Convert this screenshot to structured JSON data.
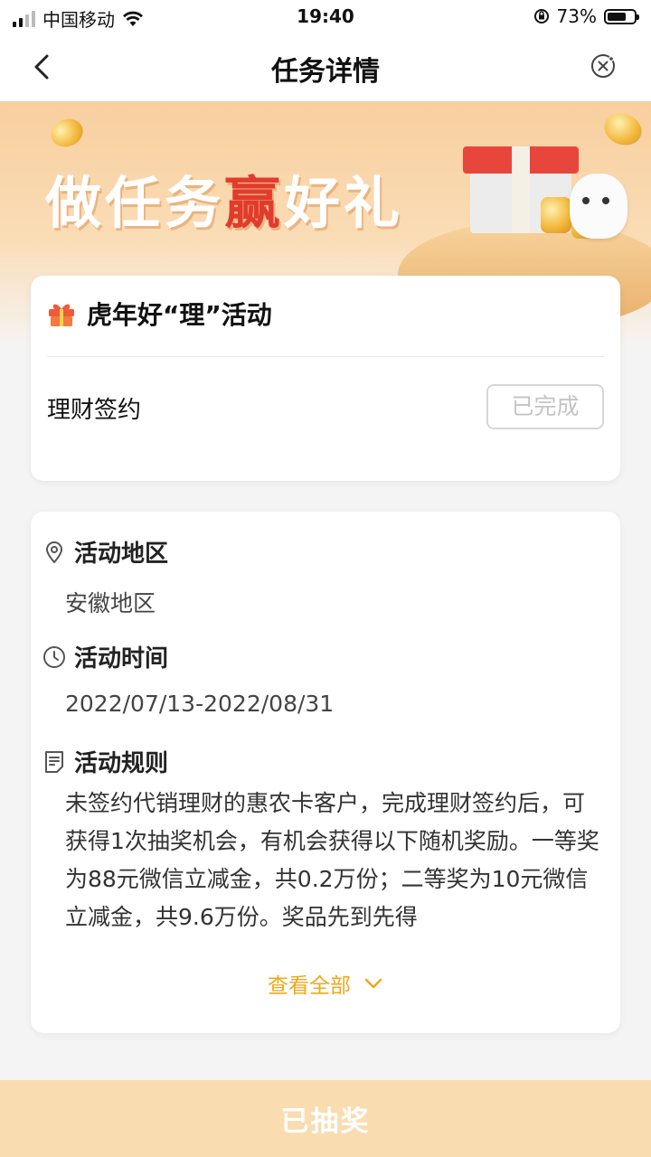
{
  "status_bar": {
    "carrier": "中国移动",
    "time": "19:40",
    "battery_text": "73%",
    "battery_level": 0.73,
    "icons": [
      "signal-icon",
      "wifi-icon",
      "orientation-lock-icon",
      "battery-icon"
    ]
  },
  "nav": {
    "title": "任务详情",
    "icons": [
      "back-icon",
      "close-icon"
    ]
  },
  "banner": {
    "title_part1": "做任务",
    "title_highlight": "赢",
    "title_part2": "好礼"
  },
  "task_card": {
    "title": "虎年好“理”活动",
    "task_name": "理财签约",
    "status_button": "已完成"
  },
  "detail_card": {
    "region_label": "活动地区",
    "region_value": "安徽地区",
    "time_label": "活动时间",
    "time_value": "2022/07/13-2022/08/31",
    "rules_label": "活动规则",
    "rules_text": "未签约代销理财的惠农卡客户，完成理财签约后，可获得1次抽奖机会，有机会获得以下随机奖励。一等奖为88元微信立减金，共0.2万份；二等奖为10元微信立减金，共9.6万份。奖品先到先得",
    "view_all": "查看全部"
  },
  "bottom_button": {
    "label": "已抽奖"
  },
  "colors": {
    "accent": "#efa81a",
    "banner_highlight": "#e23b2e",
    "bottom_button_bg": "#f9dcb0"
  }
}
